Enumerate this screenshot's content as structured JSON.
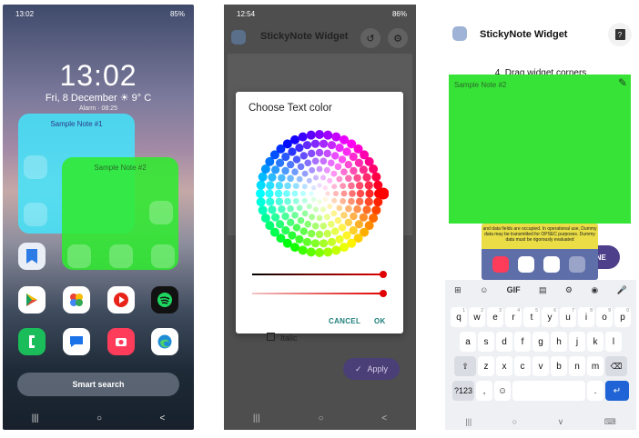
{
  "panel1": {
    "status": {
      "time": "13:02",
      "right": "85%"
    },
    "lock": {
      "clock": "13:02",
      "date": "Fri, 8 December",
      "weather": "9° C",
      "alarm": "Alarm · 08:25"
    },
    "notes": [
      {
        "title": "Sample Note #1"
      },
      {
        "title": "Sample Note #2"
      }
    ],
    "search_label": "Smart search",
    "nav": {
      "recents": "|||",
      "home": "○",
      "back": "<"
    }
  },
  "panel2": {
    "status": {
      "time": "12:54",
      "right": "86%"
    },
    "app_title": "StickyNote Widget",
    "dialog": {
      "title": "Choose Text color",
      "cancel": "CANCEL",
      "ok": "OK"
    },
    "option_label": "Italic",
    "apply_label": "Apply",
    "nav": {
      "recents": "|||",
      "home": "○",
      "back": "<"
    }
  },
  "panel3": {
    "app_title": "StickyNote Widget",
    "help_label": "?",
    "step_text": "4. Drag widget corners",
    "note_title": "Sample Note #2",
    "done_label": "DONE",
    "preview_text": "and data fields are occupied. In operational use, Dummy data may be transmitted for OPSEC purposes. Dummy data must be rigorously evaluated",
    "keyboard": {
      "tools": [
        "⊞",
        "☺",
        "GIF",
        "▤",
        "⚙",
        "◉",
        "🎤"
      ],
      "row1": [
        "q",
        "w",
        "e",
        "r",
        "t",
        "y",
        "u",
        "i",
        "o",
        "p"
      ],
      "row1_hints": [
        "1",
        "2",
        "3",
        "4",
        "5",
        "6",
        "7",
        "8",
        "9",
        "0"
      ],
      "row2": [
        "a",
        "s",
        "d",
        "f",
        "g",
        "h",
        "j",
        "k",
        "l"
      ],
      "row3": [
        "⇧",
        "z",
        "x",
        "c",
        "v",
        "b",
        "n",
        "m",
        "⌫"
      ],
      "row4": [
        "?123",
        ",",
        "☺",
        "",
        ".",
        "↵"
      ]
    },
    "nav": {
      "recents": "|||",
      "home": "○",
      "back": "∨",
      "kb": "⌨"
    }
  },
  "colors": {
    "note1": "#40e8ff",
    "note2": "#30eb30",
    "accent": "#4e3f8a",
    "dialog_button": "#1e7f7a"
  }
}
